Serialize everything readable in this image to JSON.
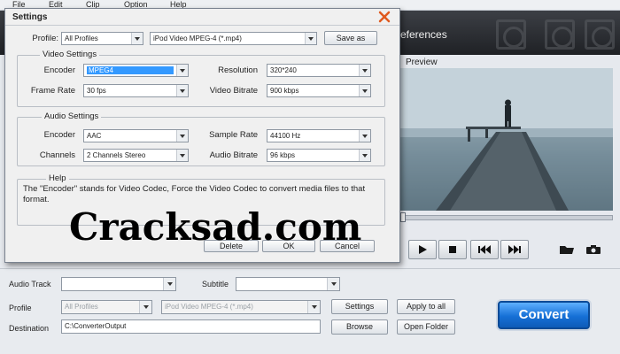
{
  "menu": [
    "File",
    "Edit",
    "Clip",
    "Option",
    "Help"
  ],
  "toolbar": {
    "preferences_label": "eferences"
  },
  "preview": {
    "title": "Preview"
  },
  "dialog": {
    "title": "Settings",
    "profile_label": "Profile:",
    "profile_category": "All Profiles",
    "profile_value": "iPod Video MPEG-4 (*.mp4)",
    "save_as_label": "Save as",
    "video": {
      "group_title": "Video Settings",
      "encoder_label": "Encoder",
      "encoder_value": "MPEG4",
      "resolution_label": "Resolution",
      "resolution_value": "320*240",
      "frame_rate_label": "Frame Rate",
      "frame_rate_value": "30 fps",
      "bitrate_label": "Video Bitrate",
      "bitrate_value": "900 kbps"
    },
    "audio": {
      "group_title": "Audio Settings",
      "encoder_label": "Encoder",
      "encoder_value": "AAC",
      "sample_rate_label": "Sample Rate",
      "sample_rate_value": "44100 Hz",
      "channels_label": "Channels",
      "channels_value": "2 Channels Stereo",
      "bitrate_label": "Audio Bitrate",
      "bitrate_value": "96 kbps"
    },
    "help": {
      "group_title": "Help",
      "text": "The \"Encoder\" stands for Video Codec, Force the Video Codec to convert media files to that format."
    },
    "delete_label": "Delete",
    "ok_label": "OK",
    "cancel_label": "Cancel"
  },
  "watermark": "Cracksad.com",
  "bottom": {
    "audio_track_label": "Audio Track",
    "audio_track_value": "",
    "subtitle_label": "Subtitle",
    "subtitle_value": "",
    "profile_label": "Profile",
    "profile_category": "All Profiles",
    "profile_value": "iPod Video MPEG-4 (*.mp4)",
    "settings_label": "Settings",
    "apply_all_label": "Apply to all",
    "destination_label": "Destination",
    "destination_value": "C:\\ConverterOutput",
    "browse_label": "Browse",
    "open_folder_label": "Open Folder",
    "convert_label": "Convert"
  },
  "colors": {
    "accent": "#1670d6",
    "selection": "#3399ff",
    "close_icon": "#e05a1f"
  }
}
